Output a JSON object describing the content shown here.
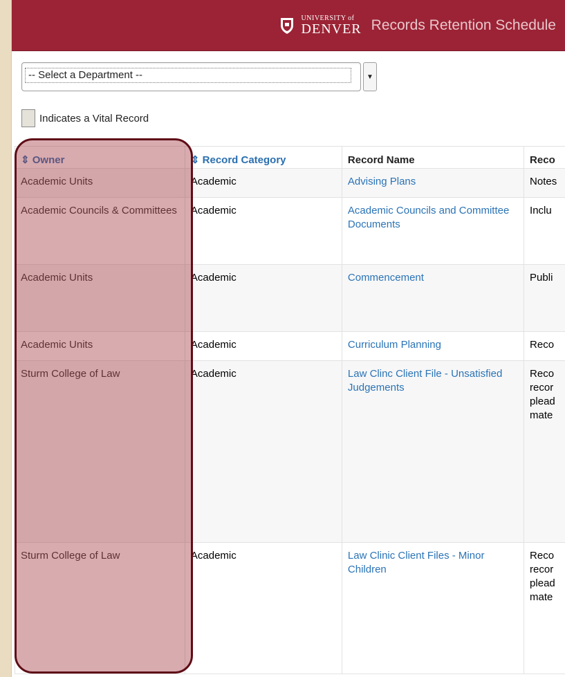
{
  "header": {
    "logo_small": "UNIVERSITY of",
    "logo_big": "DENVER",
    "site_title": "Records Retention Schedule"
  },
  "department_select": {
    "selected": "-- Select a Department --"
  },
  "legend": {
    "vital_text": "Indicates a Vital Record"
  },
  "table": {
    "columns": [
      {
        "label": "Owner",
        "sortable": true
      },
      {
        "label": "Record Category",
        "sortable": true
      },
      {
        "label": "Record Name",
        "sortable": false
      },
      {
        "label": "Reco",
        "sortable": false
      }
    ],
    "sort_icon": "⇕",
    "rows": [
      {
        "owner": "Academic Units",
        "category": "Academic",
        "name": "Advising Plans",
        "desc": "Notes"
      },
      {
        "owner": "Academic Councils & Committees",
        "category": "Academic",
        "name": "Academic Councils and Committee Documents",
        "desc": "Inclu"
      },
      {
        "owner": "Academic Units",
        "category": "Academic",
        "name": "Commencement",
        "desc": "Publi"
      },
      {
        "owner": "Academic Units",
        "category": "Academic",
        "name": "Curriculum Planning",
        "desc": "Reco"
      },
      {
        "owner": "Sturm College of Law",
        "category": "Academic",
        "name": "Law Clinc Client File - Unsatisfied Judgements",
        "desc": "Reco recor plead mate"
      },
      {
        "owner": "Sturm College of Law",
        "category": "Academic",
        "name": "Law Clinic Client Files - Minor Children",
        "desc": "Reco recor plead mate"
      }
    ]
  },
  "colors": {
    "header": "#9b2335",
    "link": "#2a73b6",
    "highlight_border": "#5e0d16"
  }
}
